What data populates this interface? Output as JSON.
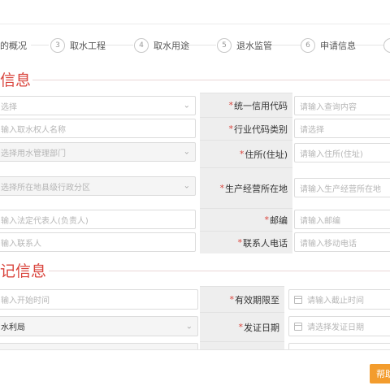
{
  "steps": [
    {
      "num": "",
      "label": "的概况"
    },
    {
      "num": "3",
      "label": "取水工程"
    },
    {
      "num": "4",
      "label": "取水用途"
    },
    {
      "num": "5",
      "label": "退水监管"
    },
    {
      "num": "6",
      "label": "申请信息"
    }
  ],
  "section1": {
    "title": "信息",
    "left_fields": [
      {
        "placeholder": "选择",
        "select": true
      },
      {
        "placeholder": "输入取水权人名称",
        "select": false
      },
      {
        "placeholder": "选择用水管理部门",
        "select": true
      },
      {
        "placeholder": "选择所在地县级行政分区",
        "select": true
      },
      {
        "placeholder": "输入法定代表人(负责人)",
        "select": false
      },
      {
        "placeholder": "输入联系人",
        "select": false
      }
    ],
    "right_rows": [
      {
        "label": "统一信用代码",
        "placeholder": "请输入查询内容"
      },
      {
        "label": "行业代码类别",
        "placeholder": "请选择"
      },
      {
        "label": "住所(住址)",
        "placeholder": "请输入住所(住址)"
      },
      {
        "label": "生产经营所在地",
        "placeholder": "请输入生产经营所在地"
      },
      {
        "label": "邮编",
        "placeholder": "请输入邮编"
      },
      {
        "label": "联系人电话",
        "placeholder": "请输入移动电话"
      }
    ]
  },
  "section2": {
    "title": "记信息",
    "left_fields": [
      {
        "placeholder": "输入开始时间",
        "value": ""
      },
      {
        "placeholder": "",
        "value": "水利局"
      }
    ],
    "right_rows": [
      {
        "label": "有效期限至",
        "placeholder": "请输入截止时间"
      },
      {
        "label": "发证日期",
        "placeholder": "请选择发证日期"
      }
    ]
  },
  "help_button": "帮助",
  "required_mark": "*",
  "icons": {
    "dropdown": "chevron-down-icon",
    "calendar": "calendar-icon"
  },
  "colors": {
    "accent_red": "#d9443c",
    "help_orange": "#f39c2d"
  }
}
